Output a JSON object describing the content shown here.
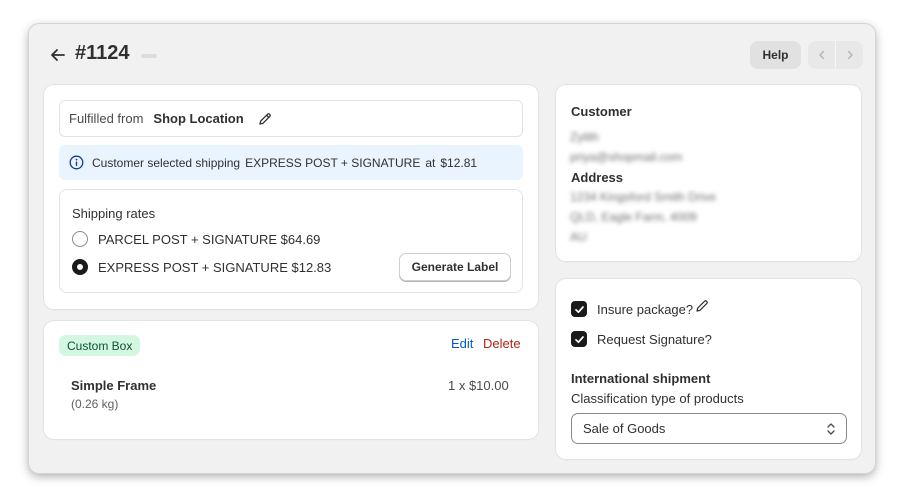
{
  "header": {
    "order_number": "#1124",
    "help_label": "Help"
  },
  "fulfillment": {
    "from_label": "Fulfilled from",
    "from_value": "Shop Location",
    "banner_prefix": "Customer selected shipping",
    "banner_method": "EXPRESS POST + SIGNATURE",
    "banner_at": "at",
    "banner_price": "$12.81",
    "rates_title": "Shipping rates",
    "rates": [
      {
        "label": "PARCEL POST + SIGNATURE $64.69",
        "selected": false
      },
      {
        "label": "EXPRESS POST + SIGNATURE $12.83",
        "selected": true
      }
    ],
    "generate_label": "Generate Label"
  },
  "box": {
    "badge": "Custom Box",
    "edit_label": "Edit",
    "delete_label": "Delete",
    "item_name": "Simple Frame",
    "item_weight": "(0.26 kg)",
    "item_qty_price": "1 x $10.00"
  },
  "customer": {
    "title": "Customer",
    "name": "Zylith",
    "email": "priya@shopmail.com",
    "address_title": "Address",
    "address_line1": "1234 Kingsford Smith Drive",
    "address_line2": "QLD, Eagle Farm, 4009",
    "address_line3": "AU"
  },
  "options": {
    "insure_label": "Insure package?",
    "insure_checked": true,
    "signature_label": "Request Signature?",
    "signature_checked": true,
    "intl_title": "International shipment",
    "classification_label": "Classification type of products",
    "classification_value": "Sale of Goods"
  },
  "colors": {
    "link": "#005bd3",
    "delete": "#b42318",
    "badge_bg": "#d4f7e1",
    "banner_bg": "#eaf4ff"
  }
}
